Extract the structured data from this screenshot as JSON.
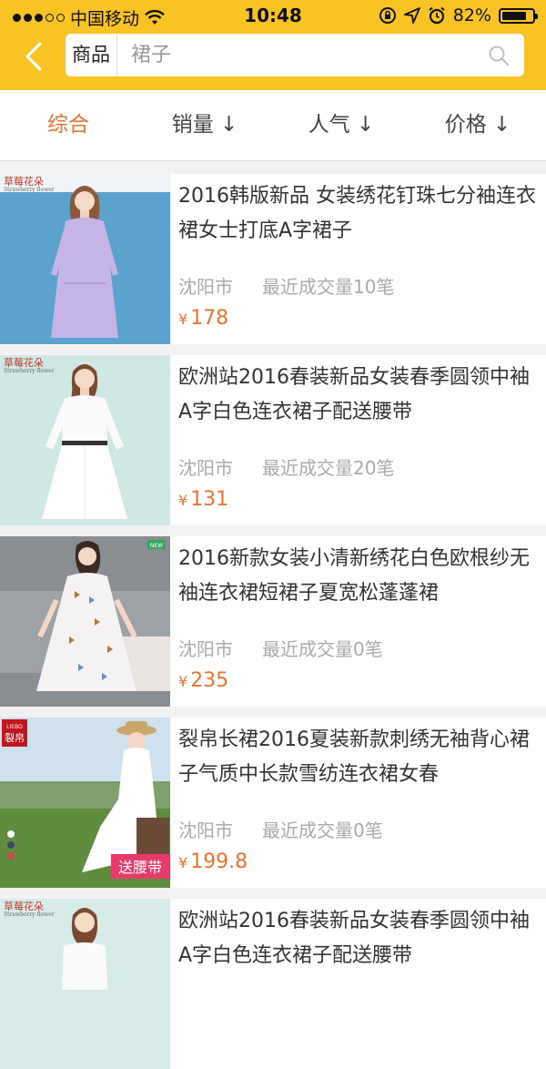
{
  "status_bar": {
    "carrier": "中国移动",
    "time": "10:48",
    "battery": "82%",
    "battery_level": 0.82
  },
  "search": {
    "category": "商品",
    "placeholder": "裙子"
  },
  "sort_tabs": [
    {
      "label": "综合",
      "active": true
    },
    {
      "label": "销量 ↓",
      "active": false
    },
    {
      "label": "人气 ↓",
      "active": false
    },
    {
      "label": "价格 ↓",
      "active": false
    }
  ],
  "products": [
    {
      "title": "2016韩版新品 女装绣花钉珠七分袖连衣裙女士打底A字裙子",
      "location": "沈阳市",
      "sold": "最近成交量10笔",
      "currency": "¥",
      "price": "178",
      "brand": "草莓花朵",
      "brand_sub": "Strawberry flower"
    },
    {
      "title": "欧洲站2016春装新品女装春季圆领中袖A字白色连衣裙子配送腰带",
      "location": "沈阳市",
      "sold": "最近成交量20笔",
      "currency": "¥",
      "price": "131",
      "brand": "草莓花朵",
      "brand_sub": "Strawberry flower"
    },
    {
      "title": "2016新款女装小清新绣花白色欧根纱无袖连衣裙短裙子夏宽松蓬蓬裙",
      "location": "沈阳市",
      "sold": "最近成交量0笔",
      "currency": "¥",
      "price": "235",
      "badge": "NEW"
    },
    {
      "title": "裂帛长裙2016夏装新款刺绣无袖背心裙子气质中长款雪纺连衣裙女春",
      "location": "沈阳市",
      "sold": "最近成交量0笔",
      "currency": "¥",
      "price": "199.8",
      "brand": "裂帛",
      "brand_sub": "LIEBO",
      "promo": "送腰带"
    },
    {
      "title": "欧洲站2016春装新品女装春季圆领中袖A字白色连衣裙子配送腰带",
      "location": "",
      "sold": "",
      "currency": "",
      "price": "",
      "brand": "草莓花朵",
      "brand_sub": "Strawberry flower"
    }
  ],
  "colors": {
    "header": "#f9c323",
    "accent": "#e8742d",
    "muted": "#aaaaaa"
  },
  "icons": {
    "back": "chevron-left-icon",
    "search": "magnifier-icon",
    "wifi": "wifi-icon",
    "location": "location-arrow-icon",
    "alarm": "alarm-icon",
    "lock": "rotation-lock-icon"
  }
}
